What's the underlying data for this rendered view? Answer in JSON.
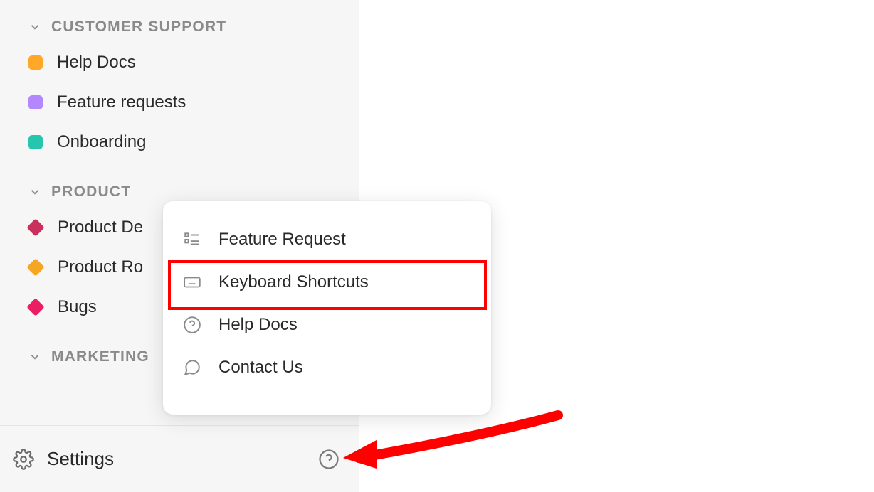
{
  "sidebar": {
    "sections": [
      {
        "label": "CUSTOMER SUPPORT",
        "items": [
          {
            "label": "Help Docs",
            "color": "orange",
            "shape": "square"
          },
          {
            "label": "Feature requests",
            "color": "purple",
            "shape": "square"
          },
          {
            "label": "Onboarding",
            "color": "teal",
            "shape": "square"
          }
        ]
      },
      {
        "label": "PRODUCT",
        "items": [
          {
            "label": "Product De",
            "color": "crimson",
            "shape": "diamond"
          },
          {
            "label": "Product Ro",
            "color": "amber",
            "shape": "diamond"
          },
          {
            "label": "Bugs",
            "color": "pink",
            "shape": "diamond"
          }
        ]
      },
      {
        "label": "MARKETING",
        "items": []
      }
    ]
  },
  "footer": {
    "settings_label": "Settings"
  },
  "popover": {
    "items": [
      {
        "label": "Feature Request",
        "icon": "list-icon"
      },
      {
        "label": "Keyboard Shortcuts",
        "icon": "keyboard-icon"
      },
      {
        "label": "Help Docs",
        "icon": "help-circle-icon"
      },
      {
        "label": "Contact Us",
        "icon": "chat-icon"
      }
    ]
  },
  "annotation": {
    "highlight_target": "Keyboard Shortcuts",
    "arrow_target": "help-button"
  }
}
